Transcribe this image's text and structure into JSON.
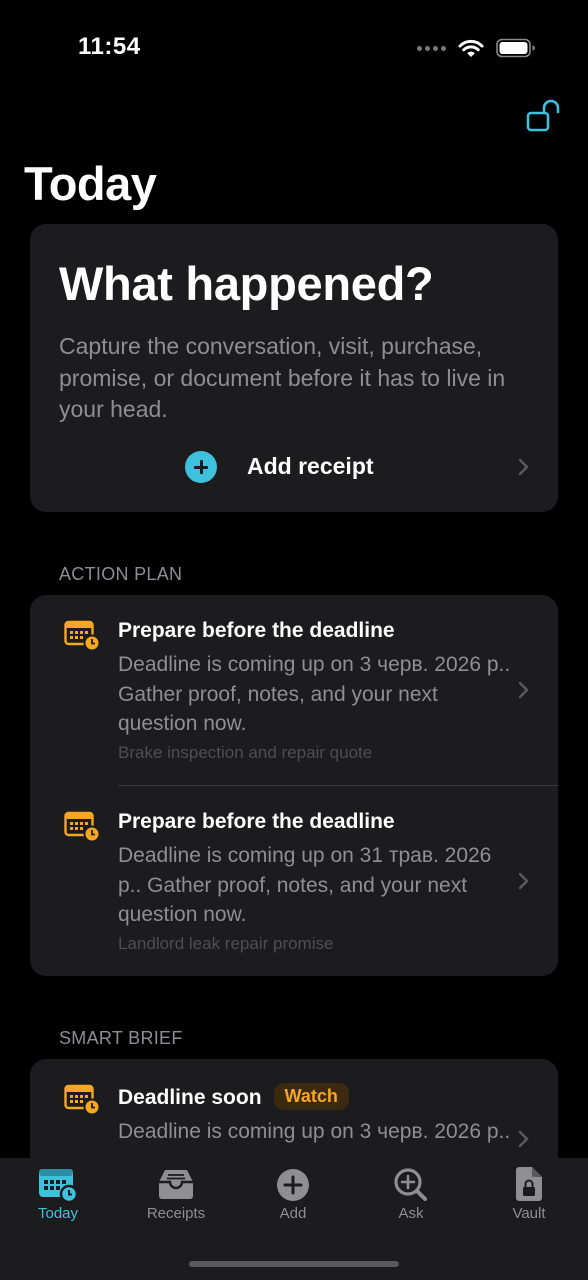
{
  "status_bar": {
    "time": "11:54"
  },
  "page": {
    "title": "Today"
  },
  "hero": {
    "title": "What happened?",
    "description": "Capture the conversation, visit, purchase, promise, or document before it has to live in your head.",
    "add_label": "Add receipt"
  },
  "action_plan": {
    "header": "ACTION PLAN",
    "items": [
      {
        "title": "Prepare before the deadline",
        "description": "Deadline is coming up on 3 черв. 2026 р.. Gather proof, notes, and your next question now.",
        "subtitle": "Brake inspection and repair quote",
        "icon": "calendar-clock-icon"
      },
      {
        "title": "Prepare before the deadline",
        "description": "Deadline is coming up on 31 трав. 2026 р.. Gather proof, notes, and your next question now.",
        "subtitle": "Landlord leak repair promise",
        "icon": "calendar-clock-icon"
      }
    ]
  },
  "smart_brief": {
    "header": "SMART BRIEF",
    "items": [
      {
        "title": "Deadline soon",
        "badge": "Watch",
        "description": "Deadline is coming up on 3 черв. 2026 р..",
        "icon": "calendar-clock-icon"
      }
    ]
  },
  "tabs": [
    {
      "label": "Today",
      "icon": "today-calendar-icon",
      "active": true
    },
    {
      "label": "Receipts",
      "icon": "inbox-tray-icon",
      "active": false
    },
    {
      "label": "Add",
      "icon": "plus-circle-icon",
      "active": false
    },
    {
      "label": "Ask",
      "icon": "magnify-plus-icon",
      "active": false
    },
    {
      "label": "Vault",
      "icon": "lock-document-icon",
      "active": false
    }
  ],
  "colors": {
    "accent": "#3ec1dc",
    "warning": "#f5a623",
    "card": "#1c1c1e",
    "secondary_text": "#8e8e93"
  }
}
